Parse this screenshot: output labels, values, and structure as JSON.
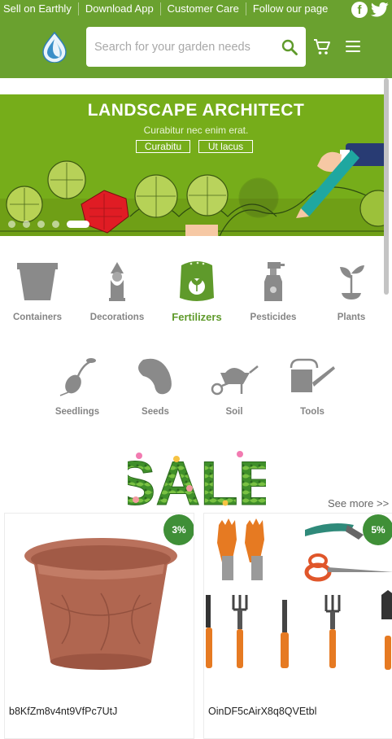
{
  "header": {
    "top_links": [
      "Sell on Earthly",
      "Download App",
      "Customer Care",
      "Follow our page"
    ],
    "social_icons": [
      "facebook-icon",
      "twitter-icon"
    ],
    "search_placeholder": "Search for your garden needs",
    "icons": [
      "logo-drop-icon",
      "search-icon",
      "cart-icon",
      "menu-icon"
    ],
    "brand_color": "#6aa12f"
  },
  "banner": {
    "title": "LANDSCAPE ARCHITECT",
    "subtitle": "Curabitur nec enim erat.",
    "button_one": "Curabitu",
    "button_two": "Ut lacus",
    "slide_count": 5,
    "active_slide": 5,
    "background": "#76ad1a"
  },
  "categories": [
    {
      "label": "Containers",
      "icon": "pot-icon",
      "active": false
    },
    {
      "label": "Decorations",
      "icon": "gnome-icon",
      "active": false
    },
    {
      "label": "Fertilizers",
      "icon": "fertilizer-bag-icon",
      "active": true
    },
    {
      "label": "Pesticides",
      "icon": "spray-bottle-icon",
      "active": false
    },
    {
      "label": "Plants",
      "icon": "sprout-icon",
      "active": false
    },
    {
      "label": "Seedlings",
      "icon": "seedling-icon",
      "active": false
    },
    {
      "label": "Seeds",
      "icon": "seed-icon",
      "active": false
    },
    {
      "label": "Soil",
      "icon": "wheelbarrow-icon",
      "active": false
    },
    {
      "label": "Tools",
      "icon": "watering-can-icon",
      "active": false
    }
  ],
  "sale": {
    "title": "SALE",
    "see_more": "See more >>"
  },
  "products": [
    {
      "name": "b8KfZm8v4nt9VfPc7UtJ",
      "discount": "3%",
      "image": "plastic-pot-image"
    },
    {
      "name": "OinDF5cAirX8q8QVEtbl",
      "discount": "5%",
      "image": "garden-tool-set-image"
    }
  ]
}
